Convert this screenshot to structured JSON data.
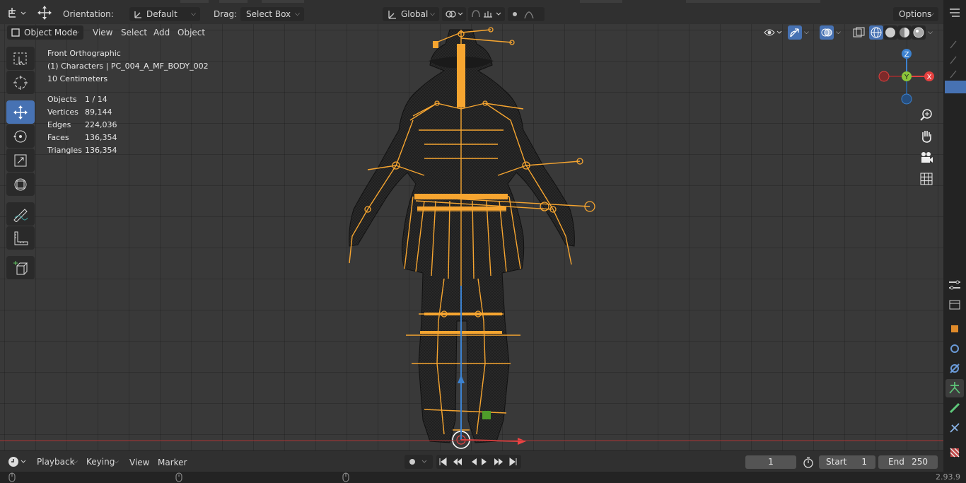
{
  "header": {
    "orientation_label": "Orientation:",
    "orientation_value": "Default",
    "drag_label": "Drag:",
    "drag_value": "Select Box",
    "transform_space": "Global",
    "options_label": "Options"
  },
  "viewport_header": {
    "mode": "Object Mode",
    "menus": [
      "View",
      "Select",
      "Add",
      "Object"
    ]
  },
  "overlay": {
    "view_name": "Front Orthographic",
    "object_info": "(1) Characters | PC_004_A_MF_BODY_002",
    "grid_scale": "10 Centimeters",
    "stats": [
      {
        "key": "Objects",
        "value": "1 / 14"
      },
      {
        "key": "Vertices",
        "value": "89,144"
      },
      {
        "key": "Edges",
        "value": "224,036"
      },
      {
        "key": "Faces",
        "value": "136,354"
      },
      {
        "key": "Triangles",
        "value": "136,354"
      }
    ]
  },
  "gizmo": {
    "x": "X",
    "y": "Y",
    "z": "Z",
    "x_color": "#e4403f",
    "y_color": "#8bc53a",
    "z_color": "#3c82d0"
  },
  "timeline": {
    "menus": [
      "Playback",
      "Keying",
      "View",
      "Marker"
    ],
    "current_frame": "1",
    "start_label": "Start",
    "start_value": "1",
    "end_label": "End",
    "end_value": "250"
  },
  "status": {
    "version": "2.93.9"
  },
  "colors": {
    "accent": "#4772b3",
    "armature": "#f6a530",
    "mesh": "#1e1e1e"
  },
  "icons": [
    "editor-type-icon",
    "move-icon",
    "orientation-icon",
    "pivot-icon",
    "snap-icon",
    "proportional-icon",
    "select-box-tool-icon",
    "cursor-tool-icon",
    "move-tool-icon",
    "rotate-tool-icon",
    "scale-tool-icon",
    "transform-tool-icon",
    "annotate-tool-icon",
    "measure-tool-icon",
    "add-cube-tool-icon",
    "zoom-icon",
    "hand-icon",
    "camera-icon",
    "grid-icon"
  ]
}
